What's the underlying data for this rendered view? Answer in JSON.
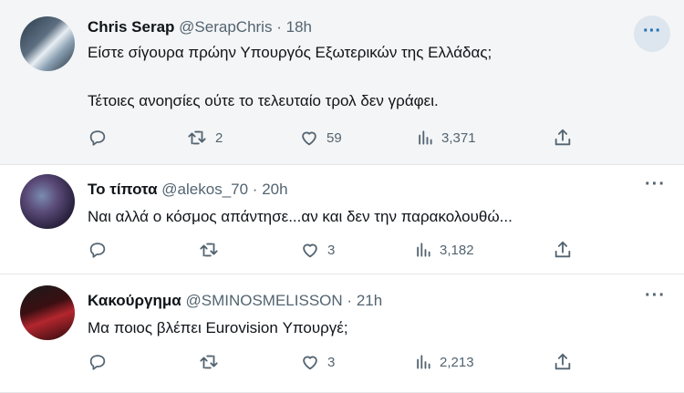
{
  "tweets": [
    {
      "author_name": "Chris Serap",
      "handle": "@SerapChris",
      "time": "18h",
      "lines": [
        "Είστε σίγουρα πρώην Υπουργός Εξωτερικών της Ελλάδας;",
        "Τέτοιες ανοησίες ούτε το τελευταίο τρολ δεν γράφει."
      ],
      "replies": "",
      "retweets": "2",
      "likes": "59",
      "views": "3,371",
      "more_icon": "ellipsis-icon"
    },
    {
      "author_name": "Το τίποτα",
      "handle": "@alekos_70",
      "time": "20h",
      "lines": [
        "Ναι αλλά ο κόσμος απάντησε...αν και δεν την παρακολουθώ..."
      ],
      "replies": "",
      "retweets": "",
      "likes": "3",
      "views": "3,182",
      "more_icon": "ellipsis-icon"
    },
    {
      "author_name": "Κακούργημα",
      "handle": "@SMINOSMELISSON",
      "time": "21h",
      "lines": [
        "Μα ποιος βλέπει Eurovision Υπουργέ;"
      ],
      "replies": "",
      "retweets": "",
      "likes": "3",
      "views": "2,213",
      "more_icon": "ellipsis-icon"
    }
  ],
  "separator": "·",
  "more_glyph": "···",
  "icons": {
    "reply": "reply-icon",
    "retweet": "retweet-icon",
    "like": "heart-icon",
    "views": "views-icon",
    "share": "share-icon"
  },
  "colors": {
    "highlight_bg": "#f4f5f6",
    "text": "#0f1419",
    "muted": "#536471",
    "accent": "#1d6fb0"
  }
}
